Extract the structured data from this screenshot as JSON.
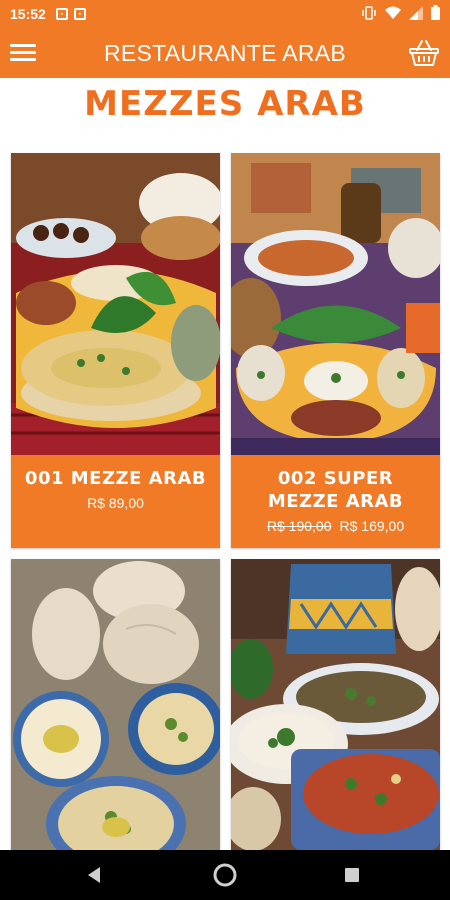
{
  "status_bar": {
    "time": "15:52",
    "icons": [
      "notification-icon",
      "calendar-icon",
      "vibrate-icon",
      "wifi-icon",
      "signal-icon",
      "battery-icon"
    ]
  },
  "app_bar": {
    "title": "RESTAURANTE ARAB",
    "menu_icon": "hamburger-menu-icon",
    "cart_icon": "basket-icon"
  },
  "section": {
    "title": "MEZZES ARAB"
  },
  "products": [
    {
      "name": "001 MEZZE ARAB",
      "old_price": "",
      "price": "R$ 89,00"
    },
    {
      "name": "002 SUPER MEZZE ARAB",
      "old_price": "R$ 190,00",
      "price": "R$ 169,00"
    },
    {
      "name": "",
      "old_price": "",
      "price": ""
    },
    {
      "name": "",
      "old_price": "",
      "price": ""
    }
  ],
  "nav_bar": {
    "icons": [
      "back-icon",
      "home-icon",
      "recent-apps-icon"
    ]
  },
  "colors": {
    "primary": "#f07a25",
    "title_orange": "#ef6f1f",
    "nav_background": "#000000"
  }
}
